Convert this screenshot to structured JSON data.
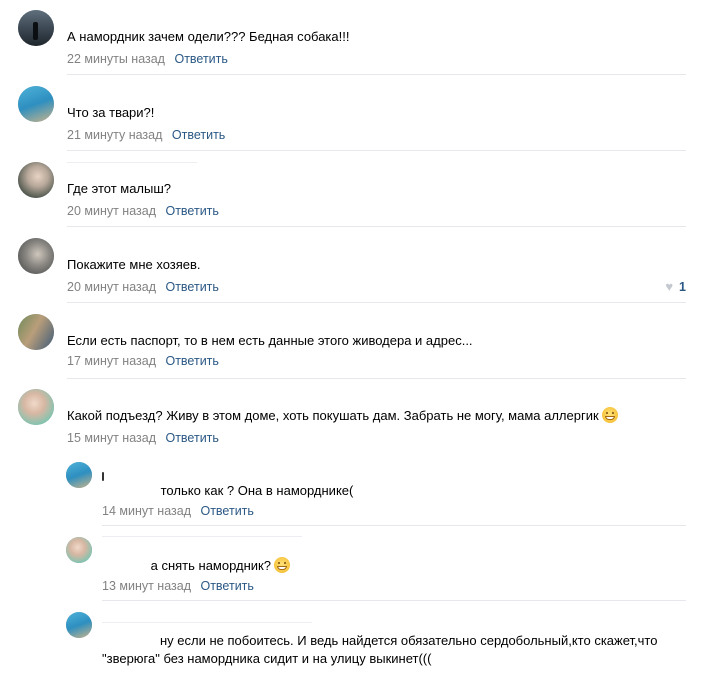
{
  "comments": [
    {
      "text": "А намордник зачем одели??? Бедная собака!!!",
      "time": "22 минуты назад",
      "reply": "Ответить"
    },
    {
      "text": "Что за твари?!",
      "time": "21 минуту назад",
      "reply": "Ответить"
    },
    {
      "text": "Где этот малыш?",
      "time": "20 минут назад",
      "reply": "Ответить"
    },
    {
      "text": "Покажите мне хозяев.",
      "time": "20 минут назад",
      "reply": "Ответить",
      "likes": "1"
    },
    {
      "text": "Если есть паспорт, то в нем есть данные этого живодера и адрес...",
      "time": "17 минут назад",
      "reply": "Ответить"
    },
    {
      "text": "Какой подъезд? Живу в этом доме, хоть покушать дам. Забрать не могу, мама аллергик",
      "time": "15 минут назад",
      "reply": "Ответить"
    }
  ],
  "replies": [
    {
      "text": "только как ? Она в наморднике(",
      "time": "14 минут назад",
      "reply": "Ответить"
    },
    {
      "text": "а снять намордник?",
      "time": "13 минут назад",
      "reply": "Ответить"
    },
    {
      "text": "ну если не побоитесь. И ведь найдется обязательно сердобольный,кто скажет,что \"зверюга\" без намордника сидит и на улицу выкинет((("
    }
  ],
  "icons": {
    "like": "heart-icon",
    "emoji": "grinning-sweat-emoji-icon"
  },
  "colors": {
    "link": "#2a5885",
    "meta": "#828282",
    "divider": "#e7e8ec"
  }
}
